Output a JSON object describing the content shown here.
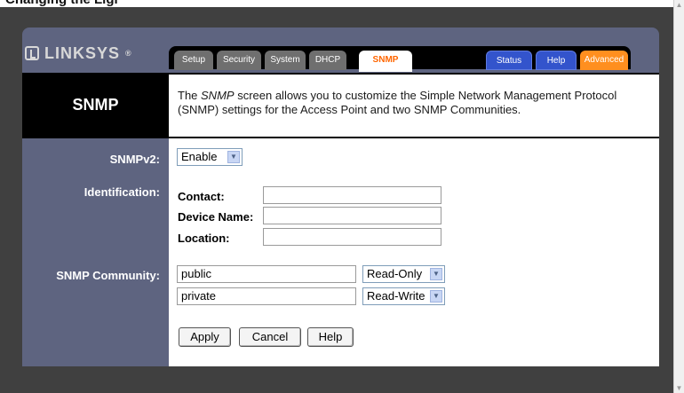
{
  "top_strip_text": "Changing the Ligi",
  "logo": {
    "text": "LINKSYS",
    "reg": "®"
  },
  "tabs": {
    "setup": "Setup",
    "security": "Security",
    "system": "System",
    "dhcp": "DHCP",
    "snmp": "SNMP",
    "status": "Status",
    "help": "Help",
    "advanced": "Advanced"
  },
  "page": {
    "title": "SNMP",
    "description_before": "The ",
    "description_em": "SNMP",
    "description_after": " screen allows you to customize the Simple Network Management Protocol (SNMP) settings for the Access Point and two SNMP Communities."
  },
  "snmpv2": {
    "label": "SNMPv2:",
    "value": "Enable"
  },
  "identification": {
    "label": "Identification:",
    "contact_label": "Contact:",
    "contact_value": "",
    "device_label": "Device Name:",
    "device_value": "",
    "location_label": "Location:",
    "location_value": ""
  },
  "community": {
    "label": "SNMP Community:",
    "rows": [
      {
        "name": "public",
        "access": "Read-Only"
      },
      {
        "name": "private",
        "access": "Read-Write"
      }
    ]
  },
  "buttons": {
    "apply": "Apply",
    "cancel": "Cancel",
    "help": "Help"
  },
  "colors": {
    "frame": "#5e6480",
    "tab_active_text": "#ff6600",
    "tab_blue": "#3354cc",
    "tab_orange": "#ff8f1f"
  }
}
